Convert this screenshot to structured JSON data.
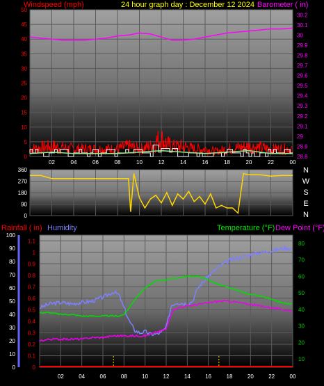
{
  "header": {
    "left_label": "Windspeed (mph)",
    "center_label": "24 hour graph day : December 12 2024",
    "right_label": "Barometer ( in)"
  },
  "direction_letters": [
    "N",
    "W",
    "S",
    "E",
    "N"
  ],
  "bottom_header": {
    "rain_label": "Rainfall ( in)",
    "humidity_label": "Humidity",
    "temp_label": "Temperature (°F)",
    "dew_label": "Dew Point (°F)"
  },
  "colors": {
    "wind": "#ff0000",
    "gust": "#ffffff",
    "avg_wind": "#90ee90",
    "barometer": "#ff00ff",
    "direction": "#ffd700",
    "rain": "#ff0000",
    "humidity": "#8080ff",
    "temperature": "#00dd00",
    "dewpoint": "#ee00ee",
    "hum_axis": "#6666ff",
    "dew_axis": "#ff00ff",
    "temp_axis": "#00cc00"
  },
  "chart_data": [
    {
      "type": "line",
      "x_tick_labels": [
        "02",
        "04",
        "06",
        "08",
        "10",
        "12",
        "14",
        "16",
        "18",
        "20",
        "22",
        "00"
      ],
      "x_ticks_hours": [
        2,
        4,
        6,
        8,
        10,
        12,
        14,
        16,
        18,
        20,
        22,
        24
      ],
      "wind_axis": {
        "ticks": [
          0,
          5,
          10,
          15,
          20,
          25,
          30,
          35,
          40,
          45,
          50
        ],
        "ylim": [
          0,
          50
        ]
      },
      "baro_axis": {
        "ticks": [
          "28.8",
          "28.9",
          "29",
          "29.1",
          "29.2",
          "29.3",
          "29.4",
          "29.5",
          "29.6",
          "29.7",
          "29.8",
          "29.9",
          "30",
          "30.1",
          "30.2"
        ],
        "ylim": [
          28.8,
          30.25
        ]
      },
      "series": [
        {
          "name": "Barometer",
          "hours": [
            0,
            1,
            2,
            3,
            4,
            5,
            6,
            7,
            8,
            9,
            10,
            11,
            12,
            13,
            14,
            15,
            16,
            17,
            18,
            19,
            20,
            21,
            22,
            23,
            24
          ],
          "values": [
            29.98,
            29.97,
            29.96,
            29.95,
            29.95,
            29.95,
            29.96,
            29.97,
            29.99,
            30.0,
            30.02,
            30.01,
            29.98,
            29.95,
            29.95,
            29.96,
            29.98,
            30.0,
            30.02,
            30.03,
            30.04,
            30.05,
            30.06,
            30.06,
            30.07
          ]
        },
        {
          "name": "Wind",
          "hours": [
            0,
            2,
            4,
            6,
            8,
            9,
            10,
            11,
            11.5,
            12,
            12.5,
            13,
            14,
            15,
            16,
            17,
            18,
            20,
            22,
            24
          ],
          "values": [
            3,
            4,
            3,
            3,
            3,
            4,
            3,
            4,
            6,
            7,
            5,
            4,
            4,
            3,
            3,
            2,
            3,
            4,
            3,
            3
          ]
        },
        {
          "name": "Avg",
          "hours": [
            0,
            2,
            4,
            6,
            8,
            10,
            12,
            14,
            16,
            18,
            20,
            22,
            24
          ],
          "values": [
            1,
            1.5,
            1,
            1,
            1,
            1.5,
            2,
            1.5,
            1,
            1.5,
            2,
            1,
            1
          ]
        }
      ]
    },
    {
      "type": "line",
      "x_tick_labels": [
        "02",
        "04",
        "06",
        "08",
        "10",
        "12",
        "14",
        "16",
        "18",
        "20",
        "22",
        "00"
      ],
      "x_ticks_hours": [
        2,
        4,
        6,
        8,
        10,
        12,
        14,
        16,
        18,
        20,
        22,
        24
      ],
      "axis": {
        "ticks": [
          0,
          90,
          180,
          270,
          360
        ],
        "ylim": [
          0,
          360
        ]
      },
      "series": [
        {
          "name": "Direction",
          "hours": [
            0,
            1,
            2,
            3,
            4,
            5,
            6,
            7,
            8,
            9,
            9.2,
            9.5,
            10,
            10.5,
            11,
            11.5,
            12,
            12.5,
            13,
            13.5,
            14,
            14.5,
            15,
            15.5,
            16,
            16.5,
            17,
            17.5,
            18,
            18.5,
            19,
            19.5,
            20,
            21,
            22,
            23,
            24
          ],
          "values": [
            315,
            315,
            290,
            290,
            290,
            290,
            290,
            290,
            290,
            290,
            30,
            330,
            140,
            60,
            130,
            160,
            100,
            180,
            80,
            170,
            130,
            190,
            110,
            150,
            90,
            170,
            60,
            80,
            60,
            60,
            20,
            330,
            320,
            320,
            310,
            315,
            315
          ]
        }
      ]
    },
    {
      "type": "line",
      "x_tick_labels": [
        "02",
        "04",
        "06",
        "08",
        "10",
        "12",
        "14",
        "16",
        "18",
        "20",
        "22",
        "00"
      ],
      "x_ticks_hours": [
        2,
        4,
        6,
        8,
        10,
        12,
        14,
        16,
        18,
        20,
        22,
        24
      ],
      "hum_axis": {
        "ticks": [
          0,
          10,
          20,
          30,
          40,
          50,
          60,
          70,
          80,
          90,
          100
        ],
        "ylim": [
          0,
          100
        ]
      },
      "rain_axis": {
        "ticks": [
          "0",
          "0.1",
          "0.2",
          "0.3",
          "0.4",
          "0.5",
          "0.6",
          "0.7",
          "0.8",
          "0.9",
          "1",
          "1.1"
        ],
        "ylim": [
          0,
          1.15
        ]
      },
      "temp_axis": {
        "ticks": [
          10,
          20,
          30,
          40,
          50,
          60,
          70,
          80
        ],
        "ylim": [
          5,
          85
        ]
      },
      "series": [
        {
          "name": "Humidity",
          "hours": [
            0,
            1,
            2,
            3,
            4,
            5,
            6,
            7,
            7.5,
            8,
            8.5,
            9,
            9.5,
            10,
            10.5,
            11,
            11.5,
            12,
            12.5,
            13,
            14,
            14.5,
            15,
            16,
            17,
            18,
            19,
            20,
            21,
            22,
            23,
            24
          ],
          "values": [
            45,
            48,
            49,
            48,
            49,
            50,
            53,
            57,
            55,
            45,
            35,
            28,
            26,
            27,
            25,
            25,
            26,
            30,
            47,
            49,
            48,
            50,
            60,
            69,
            76,
            81,
            83,
            85,
            87,
            88,
            90,
            90
          ]
        },
        {
          "name": "Temperature",
          "hours": [
            0,
            1,
            2,
            3,
            4,
            5,
            6,
            7,
            7.5,
            8,
            8.5,
            9,
            10,
            11,
            12,
            13,
            14,
            15,
            16,
            17,
            18,
            19,
            20,
            21,
            22,
            23,
            24
          ],
          "values": [
            38,
            38,
            37,
            37,
            36,
            36,
            36,
            36,
            36,
            37,
            41,
            46,
            53,
            57,
            58,
            59,
            60,
            60,
            58,
            55,
            53,
            51,
            49,
            48,
            46,
            44,
            43
          ]
        },
        {
          "name": "Dew Point",
          "hours": [
            0,
            1,
            2,
            3,
            4,
            5,
            6,
            7,
            8,
            9,
            10,
            11,
            11.5,
            12,
            12.5,
            13,
            14,
            15,
            16,
            17,
            18,
            19,
            20,
            21,
            22,
            23,
            24
          ],
          "values": [
            21,
            22,
            22,
            22,
            22,
            23,
            23,
            24,
            24,
            24,
            24,
            26,
            27,
            28,
            38,
            41,
            42,
            43,
            44,
            45,
            45,
            44,
            43,
            42,
            41,
            40,
            39
          ]
        },
        {
          "name": "Rainfall",
          "hours": [
            0,
            24
          ],
          "values": [
            0,
            0
          ]
        }
      ]
    }
  ]
}
